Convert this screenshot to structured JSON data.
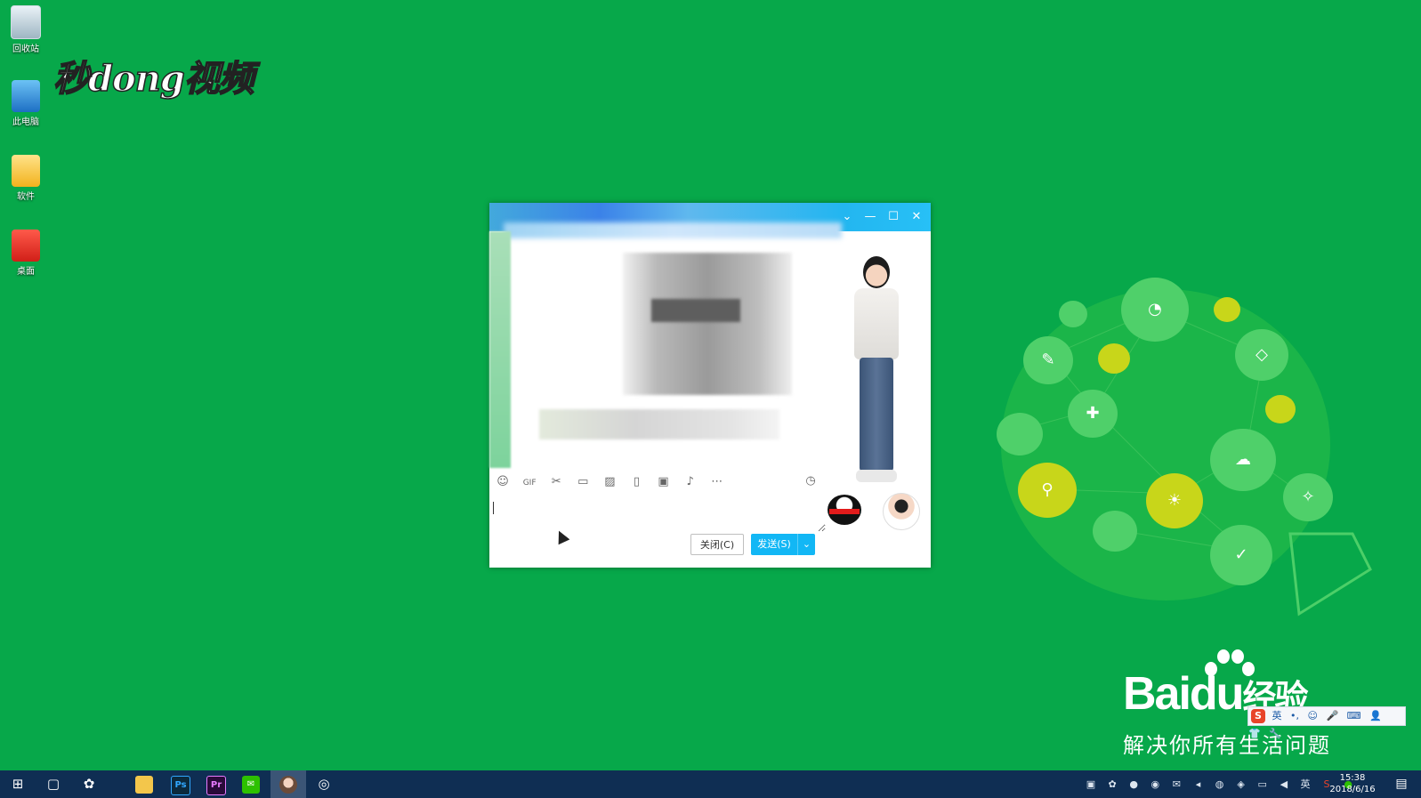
{
  "desktop": {
    "icons": [
      {
        "label": "回收站",
        "icon": "recycle-bin-icon"
      },
      {
        "label": "此电脑",
        "icon": "computer-icon"
      },
      {
        "label": "软件",
        "icon": "folder-icon"
      },
      {
        "label": "桌面",
        "icon": "desktop-app-icon"
      }
    ],
    "background_color": "#07a84a"
  },
  "watermark": {
    "text": "秒dong视频"
  },
  "chat": {
    "controls": {
      "dropdown": "⌄",
      "minimize": "—",
      "maximize": "☐",
      "close": "✕"
    },
    "toolbar": [
      {
        "name": "emoji-icon",
        "glyph": "☺"
      },
      {
        "name": "gif-icon",
        "glyph": "GIF"
      },
      {
        "name": "scissors-icon",
        "glyph": "✂"
      },
      {
        "name": "folder-icon",
        "glyph": "▭"
      },
      {
        "name": "image-icon",
        "glyph": "▨"
      },
      {
        "name": "shake-icon",
        "glyph": "▯"
      },
      {
        "name": "red-packet-icon",
        "glyph": "▣"
      },
      {
        "name": "music-icon",
        "glyph": "♪"
      },
      {
        "name": "more-icon",
        "glyph": "⋯"
      }
    ],
    "history_icon": "◷",
    "close_button": "关闭(C)",
    "send_button": "发送(S)",
    "send_dropdown": "⌄"
  },
  "baidu": {
    "logo_text": "Bai",
    "logo_du": "du",
    "logo_jy": "经验",
    "slogan": "解决你所有生活问题"
  },
  "ime": {
    "logo": "S",
    "items": [
      "英",
      "•,",
      "☺",
      "🎤",
      "⌨",
      "👤",
      "👕",
      "🔧"
    ]
  },
  "taskbar": {
    "clock_time": "15:38",
    "clock_date": "2018/6/16",
    "tray_input_lang": "英",
    "apps": [
      {
        "name": "start-button",
        "glyph": "⊞"
      },
      {
        "name": "task-view-button",
        "glyph": "▢"
      },
      {
        "name": "baidu-netdisk-button",
        "glyph": "✿"
      },
      {
        "name": "file-explorer-button",
        "glyph": ""
      },
      {
        "name": "photoshop-button",
        "glyph": "Ps"
      },
      {
        "name": "premiere-button",
        "glyph": "Pr"
      },
      {
        "name": "wechat-button",
        "glyph": "✉"
      },
      {
        "name": "qq-chat-button",
        "glyph": ""
      },
      {
        "name": "camera-app-button",
        "glyph": "◎"
      }
    ]
  }
}
